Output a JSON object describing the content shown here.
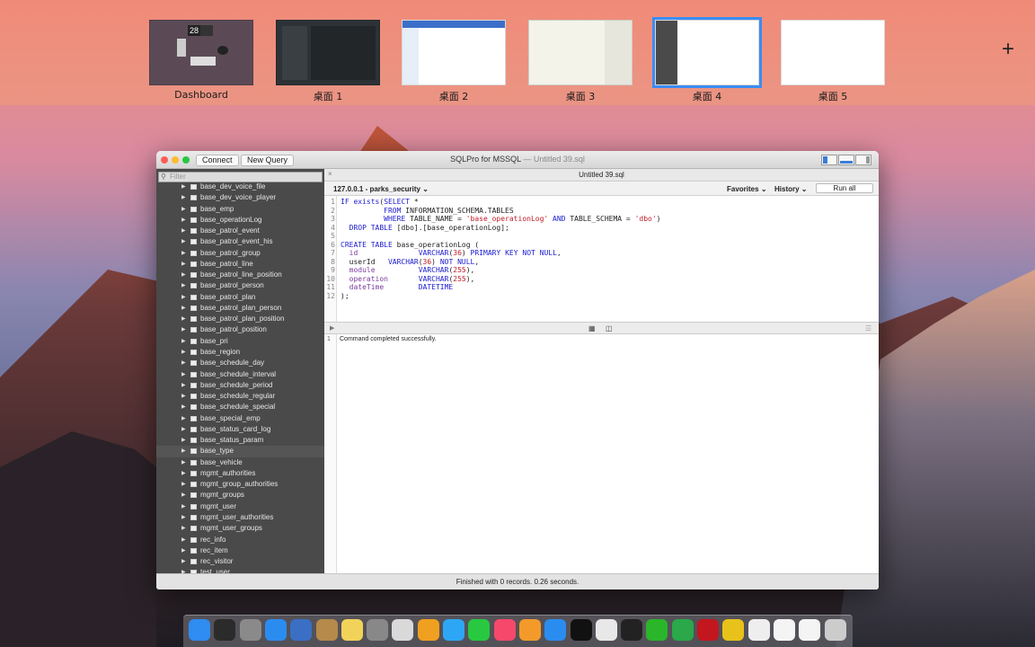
{
  "spaces": [
    {
      "label": "Dashboard",
      "active": false
    },
    {
      "label": "桌面 1",
      "active": false
    },
    {
      "label": "桌面 2",
      "active": false
    },
    {
      "label": "桌面 3",
      "active": false
    },
    {
      "label": "桌面 4",
      "active": true
    },
    {
      "label": "桌面 5",
      "active": false
    }
  ],
  "dashboard_date": "28",
  "add_space_glyph": "+",
  "window": {
    "title": "SQLPro for MSSQL",
    "subtitle": "— Untitled 39.sql",
    "connect_label": "Connect",
    "new_query_label": "New Query"
  },
  "sidebar": {
    "filter_placeholder": "Filter",
    "items": [
      "base_dev_voice_file",
      "base_dev_voice_player",
      "base_emp",
      "base_operationLog",
      "base_patrol_event",
      "base_patrol_event_his",
      "base_patrol_group",
      "base_patrol_line",
      "base_patrol_line_position",
      "base_patrol_person",
      "base_patrol_plan",
      "base_patrol_plan_person",
      "base_patrol_plan_position",
      "base_patrol_position",
      "base_pri",
      "base_region",
      "base_schedule_day",
      "base_schedule_interval",
      "base_schedule_period",
      "base_schedule_regular",
      "base_schedule_special",
      "base_special_emp",
      "base_status_card_log",
      "base_status_param",
      "base_type",
      "base_vehicle",
      "mgmt_authorities",
      "mgmt_group_authorities",
      "mgmt_groups",
      "mgmt_user",
      "mgmt_user_authorities",
      "mgmt_user_groups",
      "rec_info",
      "rec_item",
      "rec_visitor",
      "test_user"
    ],
    "selected_index": 24
  },
  "editor": {
    "tab_close": "×",
    "tab_name": "Untitled 39.sql",
    "connection": "127.0.0.1 - parks_security",
    "favorites_label": "Favorites",
    "history_label": "History",
    "run_all_label": "Run all",
    "lines": [
      "IF exists(SELECT *",
      "          FROM INFORMATION_SCHEMA.TABLES",
      "          WHERE TABLE_NAME = 'base_operationLog' AND TABLE_SCHEMA = 'dbo')",
      "  DROP TABLE [dbo].[base_operationLog];",
      "",
      "CREATE TABLE base_operationLog (",
      "  id              VARCHAR(36) PRIMARY KEY NOT NULL,",
      "  userId   VARCHAR(36) NOT NULL,",
      "  module          VARCHAR(255),",
      "  operation       VARCHAR(255),",
      "  dateTime        DATETIME",
      ");"
    ]
  },
  "results": {
    "row_number": "1",
    "message": "Command completed successfully."
  },
  "status": "Finished with 0 records. 0.26 seconds.",
  "dock": [
    "finder-icon",
    "intellij-icon",
    "launchpad-icon",
    "safari-icon",
    "preview-icon",
    "contacts-icon",
    "notes-icon",
    "system-preferences-icon",
    "photo-icon",
    "photos-icon",
    "messages-icon",
    "facetime-icon",
    "music-icon",
    "books-icon",
    "app-store-icon",
    "qq-icon",
    "chrome-icon",
    "terminal-icon",
    "wechat-icon",
    "evernote-icon",
    "netease-music-icon",
    "qq-music-icon",
    "document-icon",
    "file-icon-1",
    "file-icon-2",
    "trash-icon"
  ]
}
